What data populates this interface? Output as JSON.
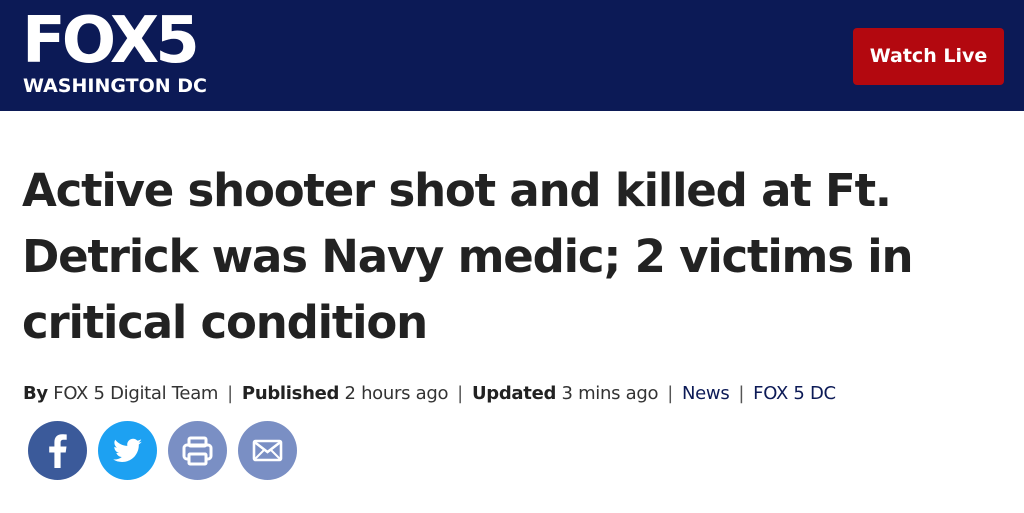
{
  "header": {
    "logo": {
      "main": "FOX5",
      "sub": "WASHINGTON DC"
    },
    "watch_live_label": "Watch Live",
    "colors": {
      "bar": "#0c1a56",
      "watch_live": "#b3080f"
    }
  },
  "article": {
    "headline": "Active shooter shot and killed at Ft. Detrick was Navy medic; 2 victims in critical condition",
    "byline": {
      "by_label": "By",
      "author": "FOX 5 Digital Team",
      "published_label": "Published",
      "published_value": "2 hours ago",
      "updated_label": "Updated",
      "updated_value": "3 mins ago",
      "category": "News",
      "station": "FOX 5 DC",
      "separator": "|"
    }
  },
  "share": {
    "buttons": [
      {
        "name": "facebook",
        "icon": "facebook-icon",
        "color": "#3b5a9a"
      },
      {
        "name": "twitter",
        "icon": "twitter-icon",
        "color": "#1da1f2"
      },
      {
        "name": "print",
        "icon": "print-icon",
        "color": "#7a8fc4"
      },
      {
        "name": "email",
        "icon": "email-icon",
        "color": "#7a8fc4"
      }
    ]
  }
}
